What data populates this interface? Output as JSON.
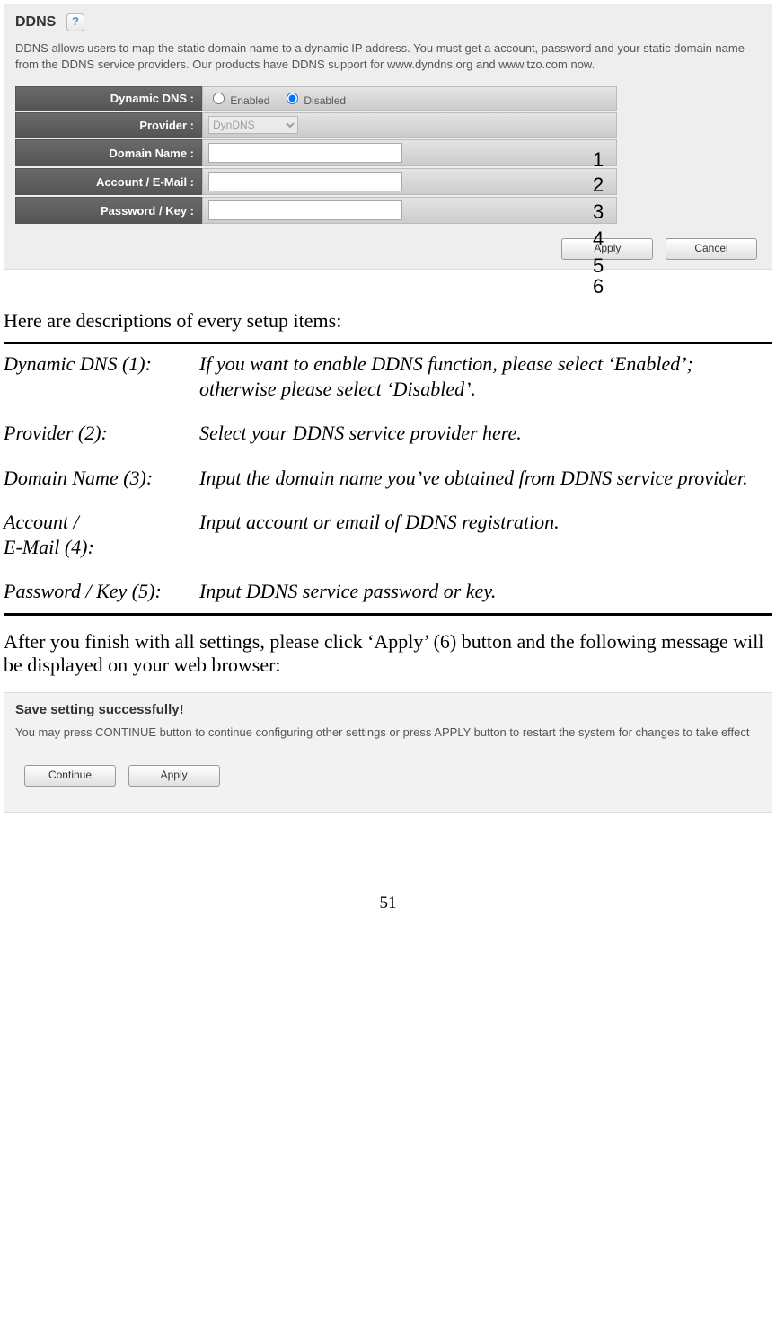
{
  "panel1": {
    "title": "DDNS",
    "helpIcon": "?",
    "desc": "DDNS allows users to map the static domain name to a dynamic IP address. You must get a account, password and your static domain name from the DDNS service providers. Our products have DDNS support for www.dyndns.org and www.tzo.com now.",
    "rows": {
      "r1": {
        "label": "Dynamic DNS :",
        "enabled": "Enabled",
        "disabled": "Disabled",
        "num": "1"
      },
      "r2": {
        "label": "Provider :",
        "option": "DynDNS",
        "num": "2"
      },
      "r3": {
        "label": "Domain Name :",
        "num": "3"
      },
      "r4": {
        "label": "Account / E-Mail :",
        "num": "4"
      },
      "r5": {
        "label": "Password / Key :",
        "num": "5"
      }
    },
    "apply": "Apply",
    "cancel": "Cancel",
    "num6": "6"
  },
  "intro": "Here are descriptions of every setup items:",
  "descTable": {
    "d1": {
      "label": "Dynamic DNS (1):",
      "text": "If you want to enable DDNS function, please select ‘Enabled’; otherwise please select ‘Disabled’."
    },
    "d2": {
      "label": "Provider (2):",
      "text": "Select your DDNS service provider here."
    },
    "d3": {
      "label": "Domain Name (3):",
      "text": "Input the domain name you’ve obtained from DDNS service provider."
    },
    "d4": {
      "label1": "Account /",
      "label2": "E-Mail (4):",
      "text": "Input account or email of DDNS registration."
    },
    "d5": {
      "label": "Password / Key (5):",
      "text": "Input DDNS service password or key."
    }
  },
  "after": "After you finish with all settings, please click ‘Apply’ (6) button and the following message will be displayed on your web browser:",
  "panel2": {
    "title": "Save setting successfully!",
    "desc": "You may press CONTINUE button to continue configuring other settings or press APPLY button to restart the system for changes to take effect",
    "continue": "Continue",
    "apply": "Apply"
  },
  "pageNum": "51"
}
